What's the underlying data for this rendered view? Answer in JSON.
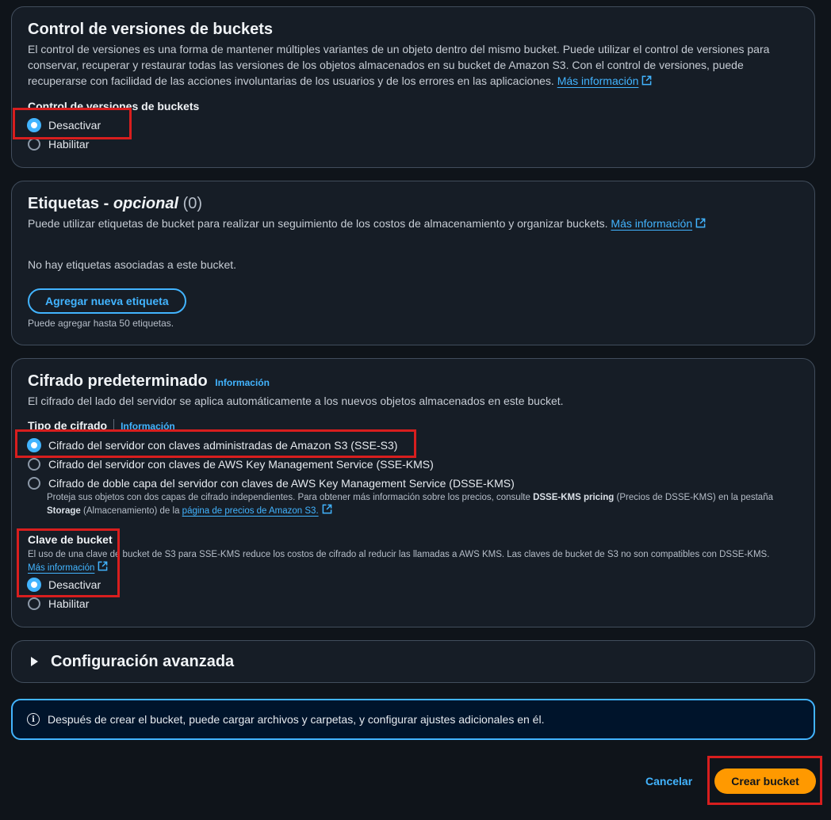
{
  "versioning": {
    "title": "Control de versiones de buckets",
    "description": "El control de versiones es una forma de mantener múltiples variantes de un objeto dentro del mismo bucket. Puede utilizar el control de versiones para conservar, recuperar y restaurar todas las versiones de los objetos almacenados en su bucket de Amazon S3. Con el control de versiones, puede recuperarse con facilidad de las acciones involuntarias de los usuarios y de los errores en las aplicaciones.",
    "more_info": "Más información",
    "field_label": "Control de versiones de buckets",
    "options": [
      "Desactivar",
      "Habilitar"
    ],
    "selected": "Desactivar"
  },
  "tags": {
    "title": "Etiquetas -",
    "title_optional": "opcional",
    "count": "(0)",
    "description": "Puede utilizar etiquetas de bucket para realizar un seguimiento de los costos de almacenamiento y organizar buckets.",
    "more_info": "Más información",
    "empty_text": "No hay etiquetas asociadas a este bucket.",
    "add_button": "Agregar nueva etiqueta",
    "limit_note": "Puede agregar hasta 50 etiquetas."
  },
  "encryption": {
    "title": "Cifrado predeterminado",
    "info_link": "Información",
    "description": "El cifrado del lado del servidor se aplica automáticamente a los nuevos objetos almacenados en este bucket.",
    "type_label": "Tipo de cifrado",
    "type_info": "Información",
    "options": [
      "Cifrado del servidor con claves administradas de Amazon S3 (SSE-S3)",
      "Cifrado del servidor con claves de AWS Key Management Service (SSE-KMS)",
      "Cifrado de doble capa del servidor con claves de AWS Key Management Service (DSSE-KMS)"
    ],
    "selected": "Cifrado del servidor con claves administradas de Amazon S3 (SSE-S3)",
    "dsse_note_1": "Proteja sus objetos con dos capas de cifrado independientes. Para obtener más información sobre los precios, consulte ",
    "dsse_note_bold_1": "DSSE-KMS pricing",
    "dsse_note_2": " (Precios de DSSE-KMS) en la pestaña ",
    "dsse_note_bold_2": "Storage",
    "dsse_note_3": " (Almacenamiento) de la ",
    "dsse_note_link": "página de precios de Amazon S3.",
    "bucket_key_label": "Clave de bucket",
    "bucket_key_desc": "El uso de una clave de bucket de S3 para SSE-KMS reduce los costos de cifrado al reducir las llamadas a AWS KMS. Las claves de bucket de S3 no son compatibles con DSSE-KMS.",
    "bucket_key_more": "Más información",
    "bucket_key_options": [
      "Desactivar",
      "Habilitar"
    ],
    "bucket_key_selected": "Desactivar"
  },
  "advanced": {
    "title": "Configuración avanzada"
  },
  "alert": {
    "text": "Después de crear el bucket, puede cargar archivos y carpetas, y configurar ajustes adicionales en él."
  },
  "footer": {
    "cancel": "Cancelar",
    "create": "Crear bucket"
  },
  "colors": {
    "background": "#0f141a",
    "panel": "#161d26",
    "link": "#42b4ff",
    "primary": "#ff9900",
    "highlight": "#d81e1e"
  }
}
